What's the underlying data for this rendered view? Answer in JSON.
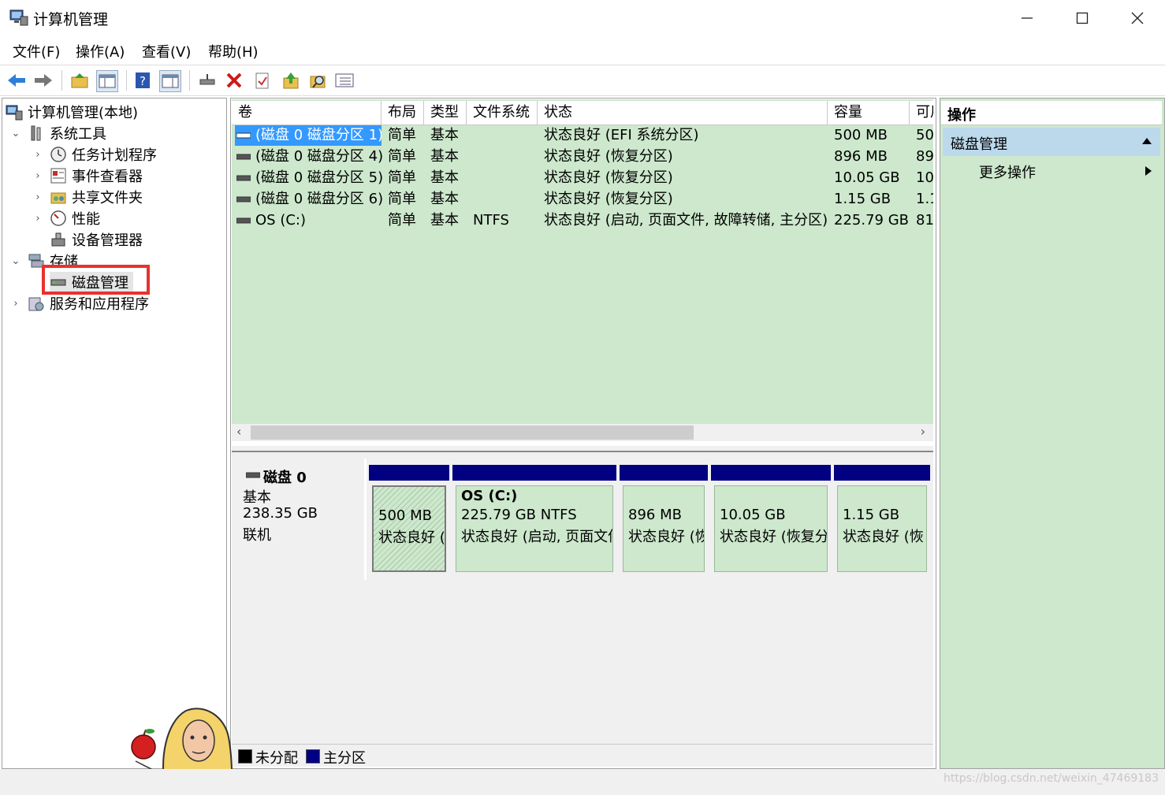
{
  "window": {
    "title": "计算机管理"
  },
  "menu": [
    "文件(F)",
    "操作(A)",
    "查看(V)",
    "帮助(H)"
  ],
  "tree": {
    "root": "计算机管理(本地)",
    "system_tools": "系统工具",
    "task_scheduler": "任务计划程序",
    "event_viewer": "事件查看器",
    "shared_folders": "共享文件夹",
    "performance": "性能",
    "device_manager": "设备管理器",
    "storage": "存储",
    "disk_management": "磁盘管理",
    "services_apps": "服务和应用程序"
  },
  "volume_list": {
    "columns": [
      "卷",
      "布局",
      "类型",
      "文件系统",
      "状态",
      "容量",
      "可用"
    ],
    "rows": [
      {
        "volume": "(磁盘 0 磁盘分区 1)",
        "layout": "简单",
        "type": "基本",
        "fs": "",
        "status": "状态良好 (EFI 系统分区)",
        "capacity": "500 MB",
        "free": "50"
      },
      {
        "volume": "(磁盘 0 磁盘分区 4)",
        "layout": "简单",
        "type": "基本",
        "fs": "",
        "status": "状态良好 (恢复分区)",
        "capacity": "896 MB",
        "free": "89"
      },
      {
        "volume": "(磁盘 0 磁盘分区 5)",
        "layout": "简单",
        "type": "基本",
        "fs": "",
        "status": "状态良好 (恢复分区)",
        "capacity": "10.05 GB",
        "free": "10"
      },
      {
        "volume": "(磁盘 0 磁盘分区 6)",
        "layout": "简单",
        "type": "基本",
        "fs": "",
        "status": "状态良好 (恢复分区)",
        "capacity": "1.15 GB",
        "free": "1.1"
      },
      {
        "volume": "OS (C:)",
        "layout": "简单",
        "type": "基本",
        "fs": "NTFS",
        "status": "状态良好 (启动, 页面文件, 故障转储, 主分区)",
        "capacity": "225.79 GB",
        "free": "81"
      }
    ]
  },
  "disk": {
    "name": "磁盘 0",
    "type": "基本",
    "size": "238.35 GB",
    "state": "联机",
    "partitions": [
      {
        "line1": "500 MB",
        "line2": "状态良好 ("
      },
      {
        "title": "OS  (C:)",
        "line1": "225.79 GB NTFS",
        "line2": "状态良好 (启动, 页面文件"
      },
      {
        "line1": "896 MB",
        "line2": "状态良好 (恢"
      },
      {
        "line1": "10.05 GB",
        "line2": "状态良好 (恢复分"
      },
      {
        "line1": "1.15 GB",
        "line2": "状态良好 (恢"
      }
    ]
  },
  "legend": {
    "unallocated": "未分配",
    "primary": "主分区"
  },
  "actions": {
    "header": "操作",
    "section": "磁盘管理",
    "more": "更多操作"
  },
  "watermark": "https://blog.csdn.net/weixin_47469183",
  "colors": {
    "primary_partition": "#000080",
    "list_bg": "#cde8cd",
    "highlight_box": "#e8322f",
    "selection": "#3399ff"
  }
}
